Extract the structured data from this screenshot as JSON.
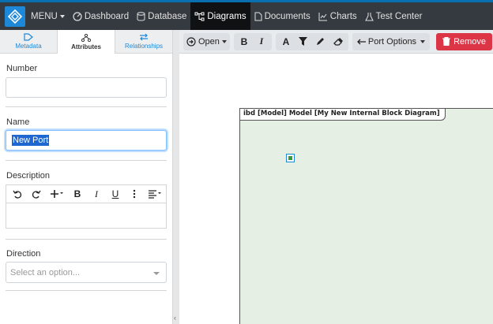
{
  "nav": {
    "menu_label": "MENU",
    "items": [
      {
        "label": "Dashboard",
        "icon": "dashboard-icon"
      },
      {
        "label": "Database",
        "icon": "database-icon"
      },
      {
        "label": "Diagrams",
        "icon": "diagrams-icon",
        "active": true
      },
      {
        "label": "Documents",
        "icon": "documents-icon"
      },
      {
        "label": "Charts",
        "icon": "charts-icon"
      },
      {
        "label": "Test Center",
        "icon": "flask-icon"
      }
    ]
  },
  "left_panel": {
    "tabs": [
      {
        "label": "Metadata",
        "icon": "tag-icon"
      },
      {
        "label": "Attributes",
        "icon": "sitemap-icon",
        "active": true
      },
      {
        "label": "Relationships",
        "icon": "swap-icon"
      }
    ],
    "number_label": "Number",
    "number_value": "",
    "name_label": "Name",
    "name_value": "New Port",
    "description_label": "Description",
    "direction_label": "Direction",
    "direction_placeholder": "Select an option..."
  },
  "toolbar": {
    "open_label": "Open",
    "bold": "B",
    "italic": "I",
    "font_color": "A",
    "port_options_label": "Port Options",
    "remove_label": "Remove"
  },
  "diagram": {
    "frame_title": "ibd [Model] Model [My New Internal Block Diagram]"
  },
  "colors": {
    "nav_bg": "#343a40",
    "accent": "#1e88d8",
    "remove": "#dc3545",
    "frame_bg": "#e6efe4"
  }
}
